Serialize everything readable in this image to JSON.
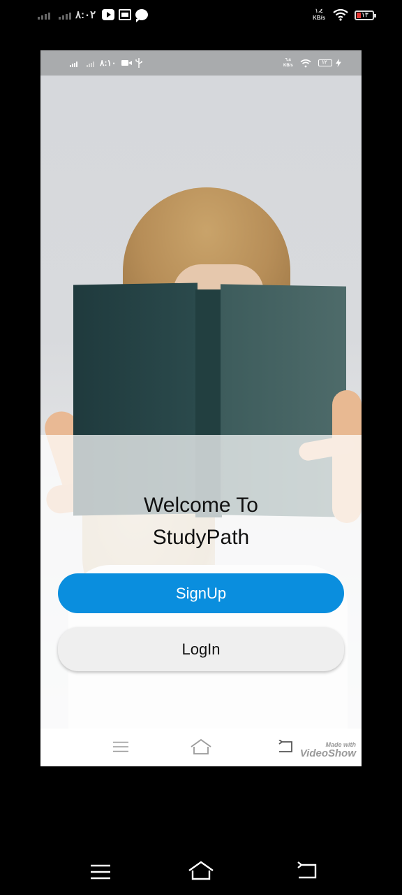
{
  "outer_status_bar": {
    "time": "٨:٠٢",
    "net_speed_value": "١،٤",
    "net_speed_unit": "KB/s",
    "battery": "١٣",
    "battery_color": "#e53935",
    "icons": [
      "signal-icon",
      "youtube-icon",
      "document-icon",
      "chat-icon",
      "wifi-icon",
      "battery-icon"
    ]
  },
  "inner_status_bar": {
    "time": "٨:١٠",
    "net_speed_value": "٦،٨",
    "net_speed_unit": "KB/s",
    "battery": "١٢",
    "icons": [
      "signal-icon",
      "camera-icon",
      "usb-icon",
      "wifi-icon",
      "battery-icon",
      "charging-icon"
    ]
  },
  "welcome": {
    "line1": "Welcome To",
    "line2": "StudyPath"
  },
  "buttons": {
    "signup_label": "SignUp",
    "login_label": "LogIn",
    "signup_color": "#0a8ede"
  },
  "watermark": {
    "line1": "Made with",
    "line2": "VideoShow"
  }
}
